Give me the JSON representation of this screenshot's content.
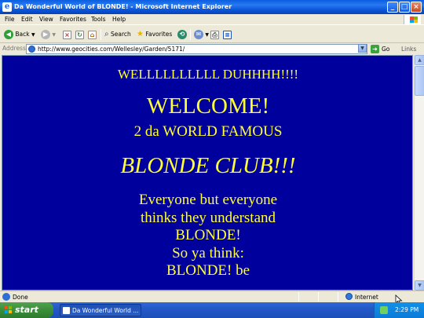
{
  "window": {
    "title": "Da Wonderful World of BLONDE! - Microsoft Internet Explorer",
    "app_icon": "ie-icon",
    "buttons": {
      "minimize": "_",
      "maximize": "□",
      "close": "×"
    }
  },
  "menu": {
    "items": [
      "File",
      "Edit",
      "View",
      "Favorites",
      "Tools",
      "Help"
    ]
  },
  "toolbar": {
    "back_label": "Back",
    "search_label": "Search",
    "favorites_label": "Favorites"
  },
  "address": {
    "label": "Address",
    "url": "http://www.geocities.com/Wellesley/Garden/5171/",
    "go_label": "Go",
    "links_label": "Links"
  },
  "page": {
    "background_color": "#00009d",
    "text_color": "#ffff33",
    "line1": "WELLLLLLLLLL DUHHHH!!!!",
    "line2": "WELCOME!",
    "line3": "2 da WORLD FAMOUS",
    "line4": "BLONDE CLUB!!!",
    "body_lines": [
      "Everyone but everyone",
      "thinks they understand",
      "BLONDE!",
      "So ya think:",
      "BLONDE! be"
    ]
  },
  "status": {
    "text": "Done",
    "zone": "Internet"
  },
  "taskbar": {
    "start_label": "start",
    "task_label": "Da Wonderful World ...",
    "clock": "2:29 PM"
  }
}
